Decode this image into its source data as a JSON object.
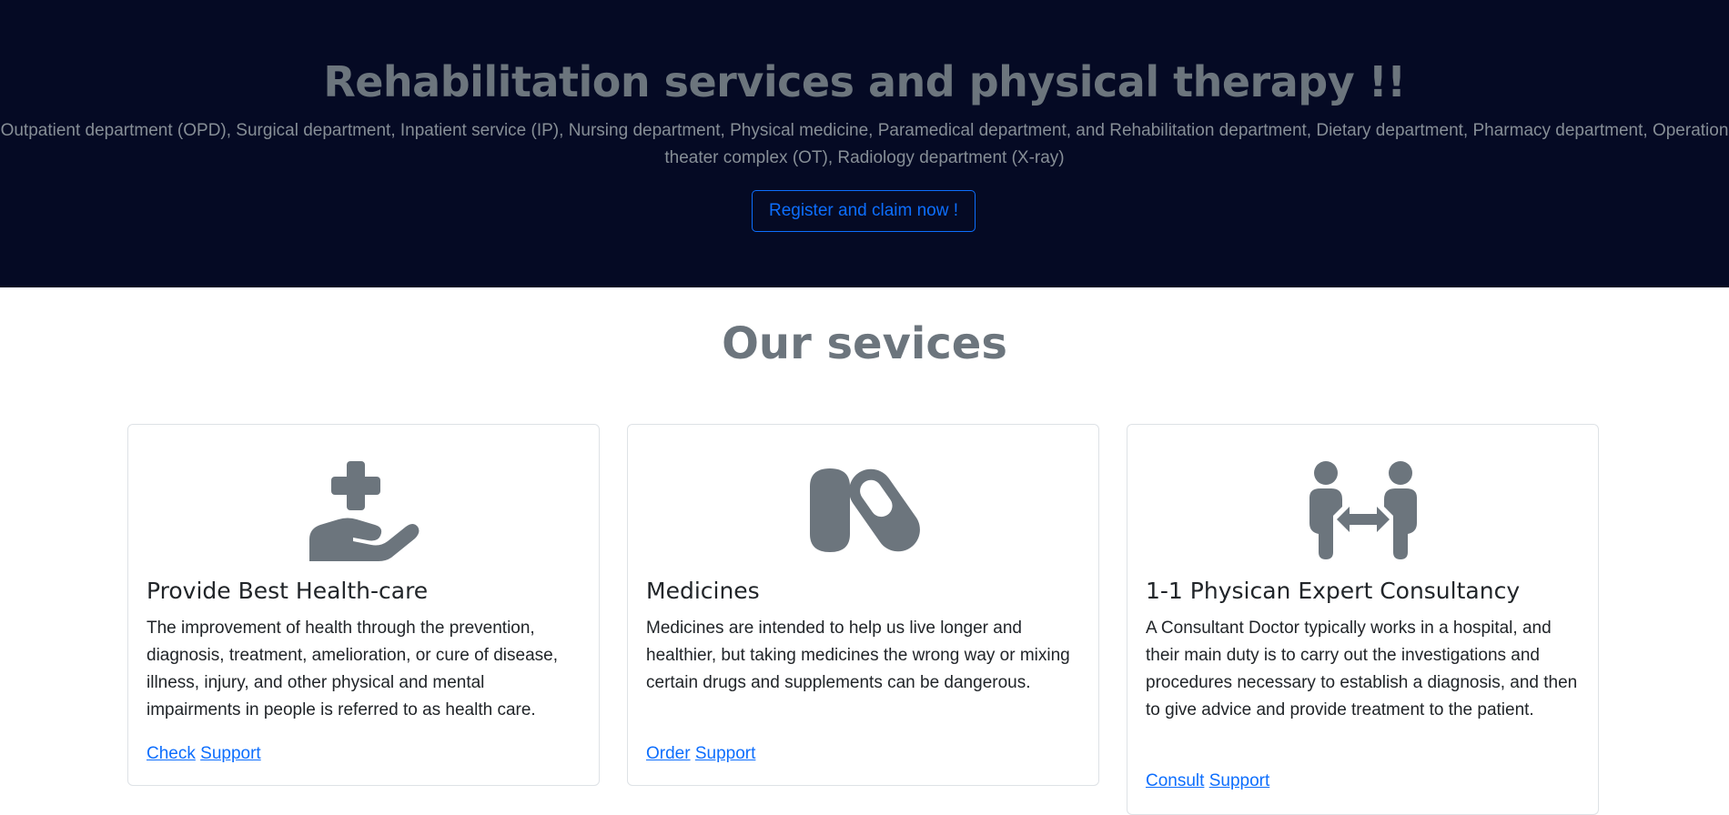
{
  "hero": {
    "title": "Rehabilitation services and physical therapy !!",
    "description": "Outpatient department (OPD), Surgical department, Inpatient service (IP), Nursing department, Physical medicine, Paramedical department, and Rehabilitation department, Dietary department, Pharmacy department, Operation theater complex (OT), Radiology department (X-ray)",
    "button_label": "Register and claim now !"
  },
  "services": {
    "title": "Our sevices",
    "cards": [
      {
        "icon": "hand-holding-medical-icon",
        "title": "Provide Best Health-care",
        "text": "The improvement of health through the prevention, diagnosis, treatment, amelioration, or cure of disease, illness, injury, and other physical and mental impairments in people is referred to as health care.",
        "link1": "Check",
        "link2": "Support"
      },
      {
        "icon": "pills-icon",
        "title": "Medicines",
        "text": "Medicines are intended to help us live longer and healthier, but taking medicines the wrong way or mixing certain drugs and supplements can be dangerous.",
        "link1": "Order",
        "link2": "Support"
      },
      {
        "icon": "people-arrows-icon",
        "title": "1-1 Physican Expert Consultancy",
        "text": "A Consultant Doctor typically works in a hospital, and their main duty is to carry out the investigations and procedures necessary to establish a diagnosis, and then to give advice and provide treatment to the patient.",
        "link1": "Consult",
        "link2": "Support"
      }
    ]
  },
  "colors": {
    "hero_bg": "#050a24",
    "muted_text": "#6c757d",
    "accent": "#0d6efd",
    "icon": "#6c757d"
  }
}
